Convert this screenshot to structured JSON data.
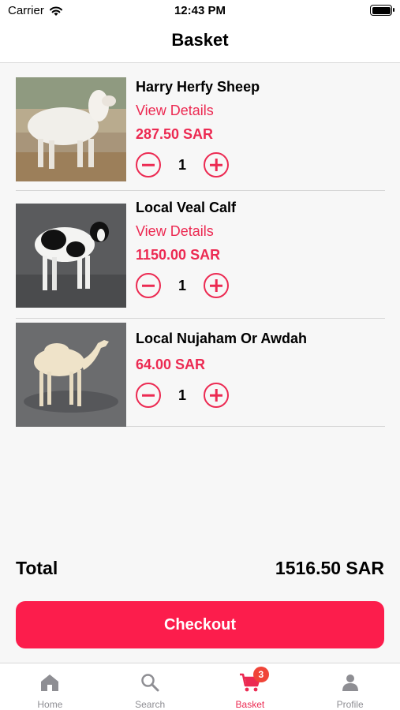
{
  "status_bar": {
    "carrier": "Carrier",
    "time": "12:43 PM"
  },
  "header": {
    "title": "Basket"
  },
  "colors": {
    "accent": "#ec2a52",
    "checkout": "#fc1d4c",
    "badge": "#f04438"
  },
  "basket": {
    "items": [
      {
        "name": "Harry Herfy Sheep",
        "view_details": "View Details",
        "price": "287.50 SAR",
        "quantity": "1"
      },
      {
        "name": "Local Veal Calf",
        "view_details": "View Details",
        "price": "1150.00 SAR",
        "quantity": "1"
      },
      {
        "name": "Local Nujaham Or Awdah",
        "price": "64.00 SAR",
        "quantity": "1"
      }
    ]
  },
  "total": {
    "label": "Total",
    "value": "1516.50 SAR"
  },
  "checkout": {
    "label": "Checkout"
  },
  "tabs": [
    {
      "label": "Home",
      "icon": "home-icon"
    },
    {
      "label": "Search",
      "icon": "search-icon"
    },
    {
      "label": "Basket",
      "icon": "cart-icon",
      "badge": "3"
    },
    {
      "label": "Profile",
      "icon": "profile-icon"
    }
  ]
}
